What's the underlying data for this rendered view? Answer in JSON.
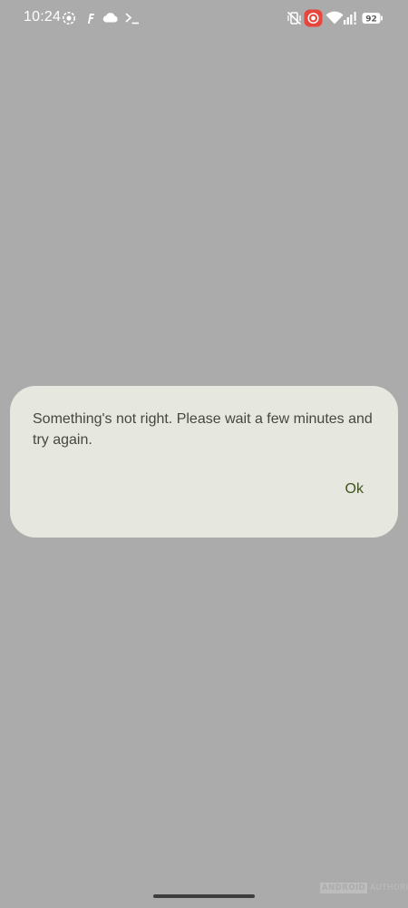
{
  "status_bar": {
    "time": "10:24",
    "battery_level": "92",
    "icons_left": [
      "focus-icon",
      "fitbit-f-icon",
      "cloud-icon",
      "terminal-icon"
    ],
    "icons_right": [
      "vibrate-off-icon",
      "screen-record-icon",
      "wifi-icon",
      "signal-icon",
      "battery-icon"
    ],
    "record_color": "#e8453c"
  },
  "dialog": {
    "message": "Something's not right. Please wait a few minutes and try again.",
    "ok_label": "Ok",
    "background_color": "#e6e7df",
    "accent_color": "#3f5220"
  },
  "watermark": {
    "brand_boxed": "ANDROID",
    "brand_plain": "AUTHORITY"
  },
  "colors": {
    "scrim": "#ababab"
  }
}
